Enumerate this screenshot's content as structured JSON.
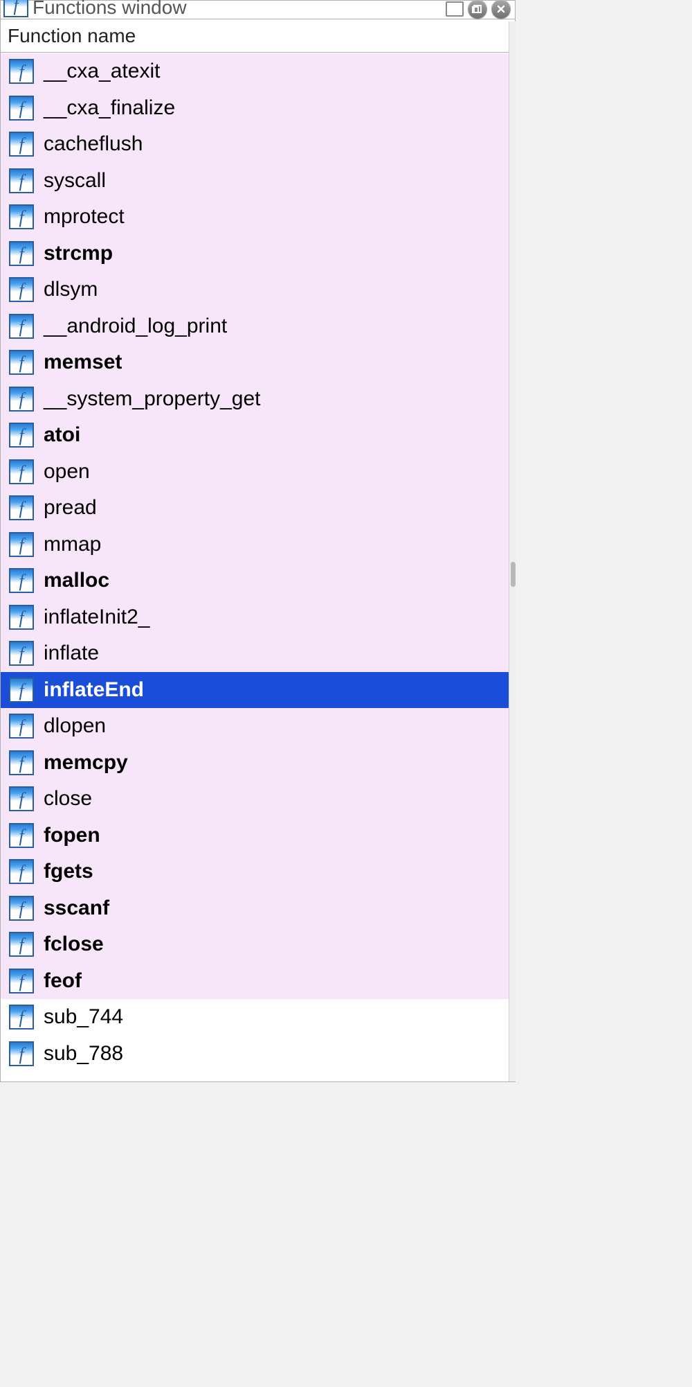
{
  "window": {
    "title": "Functions window",
    "column_header": "Function name"
  },
  "functions": [
    {
      "name": "__cxa_atexit",
      "bold": false,
      "selected": false,
      "bg": "pink"
    },
    {
      "name": "__cxa_finalize",
      "bold": false,
      "selected": false,
      "bg": "pink"
    },
    {
      "name": "cacheflush",
      "bold": false,
      "selected": false,
      "bg": "pink"
    },
    {
      "name": "syscall",
      "bold": false,
      "selected": false,
      "bg": "pink"
    },
    {
      "name": "mprotect",
      "bold": false,
      "selected": false,
      "bg": "pink"
    },
    {
      "name": "strcmp",
      "bold": true,
      "selected": false,
      "bg": "pink"
    },
    {
      "name": "dlsym",
      "bold": false,
      "selected": false,
      "bg": "pink"
    },
    {
      "name": "__android_log_print",
      "bold": false,
      "selected": false,
      "bg": "pink"
    },
    {
      "name": "memset",
      "bold": true,
      "selected": false,
      "bg": "pink"
    },
    {
      "name": "__system_property_get",
      "bold": false,
      "selected": false,
      "bg": "pink"
    },
    {
      "name": "atoi",
      "bold": true,
      "selected": false,
      "bg": "pink"
    },
    {
      "name": "open",
      "bold": false,
      "selected": false,
      "bg": "pink"
    },
    {
      "name": "pread",
      "bold": false,
      "selected": false,
      "bg": "pink"
    },
    {
      "name": "mmap",
      "bold": false,
      "selected": false,
      "bg": "pink"
    },
    {
      "name": "malloc",
      "bold": true,
      "selected": false,
      "bg": "pink"
    },
    {
      "name": "inflateInit2_",
      "bold": false,
      "selected": false,
      "bg": "pink"
    },
    {
      "name": "inflate",
      "bold": false,
      "selected": false,
      "bg": "pink"
    },
    {
      "name": "inflateEnd",
      "bold": true,
      "selected": true,
      "bg": "pink"
    },
    {
      "name": "dlopen",
      "bold": false,
      "selected": false,
      "bg": "pink"
    },
    {
      "name": "memcpy",
      "bold": true,
      "selected": false,
      "bg": "pink"
    },
    {
      "name": "close",
      "bold": false,
      "selected": false,
      "bg": "pink"
    },
    {
      "name": "fopen",
      "bold": true,
      "selected": false,
      "bg": "pink"
    },
    {
      "name": "fgets",
      "bold": true,
      "selected": false,
      "bg": "pink"
    },
    {
      "name": "sscanf",
      "bold": true,
      "selected": false,
      "bg": "pink"
    },
    {
      "name": "fclose",
      "bold": true,
      "selected": false,
      "bg": "pink"
    },
    {
      "name": "feof",
      "bold": true,
      "selected": false,
      "bg": "pink"
    },
    {
      "name": "sub_744",
      "bold": false,
      "selected": false,
      "bg": "white"
    },
    {
      "name": "sub_788",
      "bold": false,
      "selected": false,
      "bg": "white"
    }
  ]
}
